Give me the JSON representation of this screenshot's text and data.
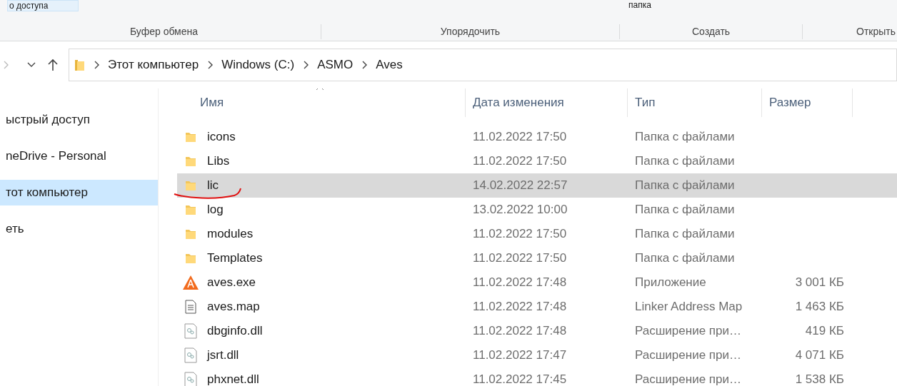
{
  "ribbon": {
    "top_labels": [
      "о доступа",
      "папка"
    ],
    "groups": [
      "Буфер обмена",
      "Упорядочить",
      "Создать",
      "Открыть"
    ]
  },
  "address_bar": {
    "path": [
      "Этот компьютер",
      "Windows (C:)",
      "ASMO",
      "Aves"
    ]
  },
  "sidebar": {
    "items": [
      {
        "label": "ыстрый доступ",
        "selected": false
      },
      {
        "label": "neDrive - Personal",
        "selected": false
      },
      {
        "label": "тот компьютер",
        "selected": true
      },
      {
        "label": "еть",
        "selected": false
      }
    ]
  },
  "table": {
    "columns": [
      "Имя",
      "Дата изменения",
      "Тип",
      "Размер"
    ],
    "rows": [
      {
        "kind": "folder",
        "name": "icons",
        "date": "11.02.2022 17:50",
        "type": "Папка с файлами",
        "selected": false
      },
      {
        "kind": "folder",
        "name": "Libs",
        "date": "11.02.2022 17:50",
        "type": "Папка с файлами",
        "selected": false
      },
      {
        "kind": "folder",
        "name": "lic",
        "date": "14.02.2022 22:57",
        "type": "Папка с файлами",
        "selected": true
      },
      {
        "kind": "folder",
        "name": "log",
        "date": "13.02.2022 10:00",
        "type": "Папка с файлами",
        "selected": false
      },
      {
        "kind": "folder",
        "name": "modules",
        "date": "11.02.2022 17:50",
        "type": "Папка с файлами",
        "selected": false
      },
      {
        "kind": "folder",
        "name": "Templates",
        "date": "11.02.2022 17:50",
        "type": "Папка с файлами",
        "selected": false
      },
      {
        "kind": "app",
        "name": "aves.exe",
        "date": "11.02.2022 17:48",
        "type": "Приложение",
        "size": "3 001 КБ",
        "selected": false
      },
      {
        "kind": "text",
        "name": "aves.map",
        "date": "11.02.2022 17:48",
        "type": "Linker Address Map",
        "size": "1 463 КБ",
        "selected": false
      },
      {
        "kind": "dll",
        "name": "dbginfo.dll",
        "date": "11.02.2022 17:48",
        "type": "Расширение при…",
        "size": "419 КБ",
        "selected": false
      },
      {
        "kind": "dll",
        "name": "jsrt.dll",
        "date": "11.02.2022 17:47",
        "type": "Расширение при…",
        "size": "4 071 КБ",
        "selected": false
      },
      {
        "kind": "dll",
        "name": "phxnet.dll",
        "date": "11.02.2022 17:45",
        "type": "Расширение при…",
        "size": "1 538 КБ",
        "selected": false
      }
    ]
  }
}
